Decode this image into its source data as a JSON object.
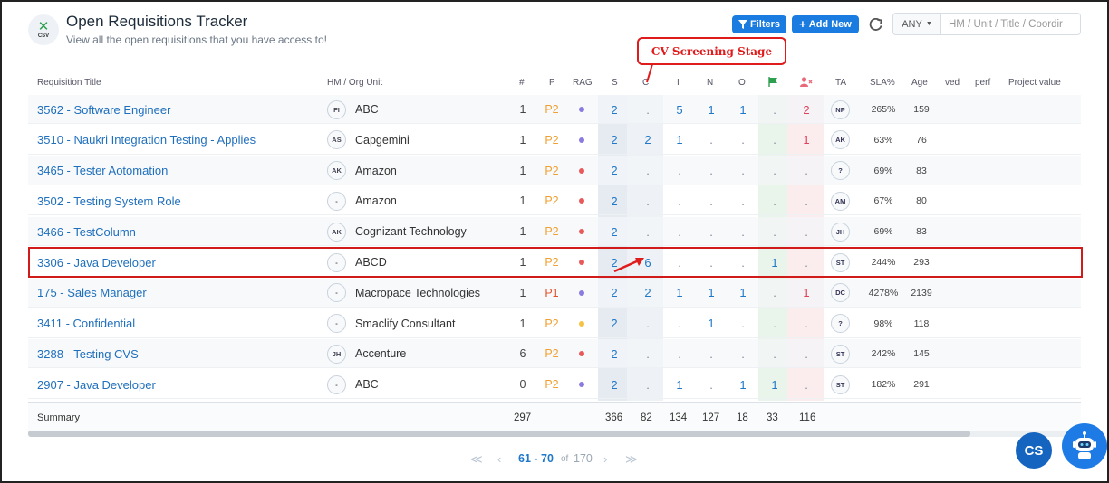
{
  "header": {
    "title": "Open Requisitions Tracker",
    "subtitle": "View all the open requisitions that you have access to!",
    "logo_text": "CSV",
    "filters_label": "Filters",
    "add_new_label": "Add New",
    "select_value": "ANY",
    "search_placeholder": "HM / Unit / Title / Coordir"
  },
  "callout": {
    "text": "CV Screening Stage"
  },
  "columns": {
    "title": "Requisition Title",
    "hm": "HM / Org Unit",
    "num": "#",
    "p": "P",
    "rag": "RAG",
    "s": "S",
    "c": "C",
    "i": "I",
    "n": "N",
    "o": "O",
    "ta": "TA",
    "sla": "SLA%",
    "age": "Age",
    "ved": "ved",
    "perf": "perf",
    "project_value": "Project value"
  },
  "colors": {
    "accent": "#1a7be0",
    "rag_purple": "#8a7be0",
    "rag_red": "#e85a5a",
    "rag_yellow": "#f5c242",
    "highlight": "#d11a1a"
  },
  "rows": [
    {
      "title": "3562 - Software Engineer",
      "hm": "FI",
      "unit": "ABC",
      "num": "1",
      "p": "P2",
      "rag": "#8a7be0",
      "s": "2",
      "c": ".",
      "i": "5",
      "n": "1",
      "o": "1",
      "f": ".",
      "r": "2",
      "ta": "NP",
      "sla": "265%",
      "age": "159"
    },
    {
      "title": "3510 - Naukri Integration Testing - Applies",
      "hm": "AS",
      "unit": "Capgemini",
      "num": "1",
      "p": "P2",
      "rag": "#8a7be0",
      "s": "2",
      "c": "2",
      "i": "1",
      "n": ".",
      "o": ".",
      "f": ".",
      "r": "1",
      "ta": "AK",
      "sla": "63%",
      "age": "76"
    },
    {
      "title": "3465 - Tester Aotomation",
      "hm": "AK",
      "unit": "Amazon",
      "num": "1",
      "p": "P2",
      "rag": "#e85a5a",
      "s": "2",
      "c": ".",
      "i": ".",
      "n": ".",
      "o": ".",
      "f": ".",
      "r": ".",
      "ta": "?",
      "sla": "69%",
      "age": "83"
    },
    {
      "title": "3502 - Testing System Role",
      "hm": "-",
      "unit": "Amazon",
      "num": "1",
      "p": "P2",
      "rag": "#e85a5a",
      "s": "2",
      "c": ".",
      "i": ".",
      "n": ".",
      "o": ".",
      "f": ".",
      "r": ".",
      "ta": "AM",
      "sla": "67%",
      "age": "80"
    },
    {
      "title": "3466 - TestColumn",
      "hm": "AK",
      "unit": "Cognizant Technology",
      "num": "1",
      "p": "P2",
      "rag": "#e85a5a",
      "s": "2",
      "c": ".",
      "i": ".",
      "n": ".",
      "o": ".",
      "f": ".",
      "r": ".",
      "ta": "JH",
      "sla": "69%",
      "age": "83"
    },
    {
      "title": "3306 - Java Developer",
      "hm": "-",
      "unit": "ABCD",
      "num": "1",
      "p": "P2",
      "rag": "#e85a5a",
      "s": "2",
      "c": "6",
      "i": ".",
      "n": ".",
      "o": ".",
      "f": "1",
      "r": ".",
      "ta": "ST",
      "sla": "244%",
      "age": "293"
    },
    {
      "title": "175 - Sales Manager",
      "hm": "-",
      "unit": "Macropace Technologies",
      "num": "1",
      "p": "P1",
      "rag": "#8a7be0",
      "s": "2",
      "c": "2",
      "i": "1",
      "n": "1",
      "o": "1",
      "f": ".",
      "r": "1",
      "ta": "DC",
      "sla": "4278%",
      "age": "2139"
    },
    {
      "title": "3411 - Confidential",
      "hm": "-",
      "unit": "Smaclify Consultant",
      "num": "1",
      "p": "P2",
      "rag": "#f5c242",
      "s": "2",
      "c": ".",
      "i": ".",
      "n": "1",
      "o": ".",
      "f": ".",
      "r": ".",
      "ta": "?",
      "sla": "98%",
      "age": "118"
    },
    {
      "title": "3288 - Testing CVS",
      "hm": "JH",
      "unit": "Accenture",
      "num": "6",
      "p": "P2",
      "rag": "#e85a5a",
      "s": "2",
      "c": ".",
      "i": ".",
      "n": ".",
      "o": ".",
      "f": ".",
      "r": ".",
      "ta": "ST",
      "sla": "242%",
      "age": "145"
    },
    {
      "title": "2907 - Java Developer",
      "hm": "-",
      "unit": "ABC",
      "num": "0",
      "p": "P2",
      "rag": "#8a7be0",
      "s": "2",
      "c": ".",
      "i": "1",
      "n": ".",
      "o": "1",
      "f": "1",
      "r": ".",
      "ta": "ST",
      "sla": "182%",
      "age": "291"
    }
  ],
  "summary": {
    "label": "Summary",
    "num": "297",
    "s": "366",
    "c": "82",
    "i": "134",
    "n": "127",
    "o": "18",
    "f": "33",
    "r": "116"
  },
  "pagination": {
    "range": "61 - 70",
    "of": "of",
    "total": "170"
  },
  "cs_button": "CS"
}
